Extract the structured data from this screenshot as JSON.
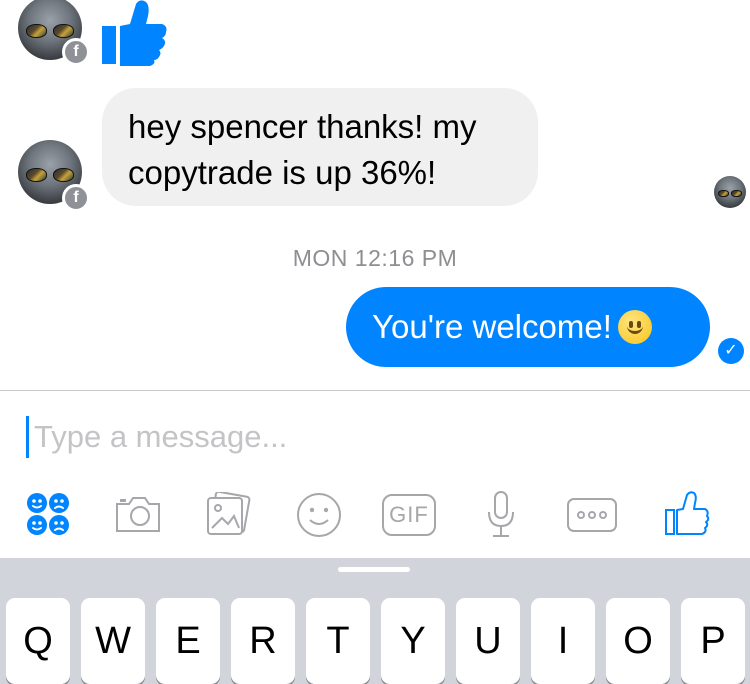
{
  "conversation": {
    "messages": [
      {
        "from": "contact",
        "type": "like"
      },
      {
        "from": "contact",
        "type": "text",
        "lines": [
          "hey spencer thanks! my",
          "copytrade is up 36%!"
        ]
      },
      {
        "from": "me",
        "type": "text",
        "text": "You're welcome!",
        "emoji": "slightly-smiling-face"
      }
    ],
    "timestamp": "MON 12:16 PM",
    "contact_badge": "f"
  },
  "composer": {
    "placeholder": "Type a message..."
  },
  "toolbar": {
    "gif_label": "GIF",
    "items": [
      "stickers-icon",
      "camera-icon",
      "gallery-icon",
      "emoji-icon",
      "gif-button",
      "microphone-icon",
      "more-icon",
      "like-icon"
    ]
  },
  "keyboard": {
    "row1": [
      "Q",
      "W",
      "E",
      "R",
      "T",
      "Y",
      "U",
      "I",
      "O",
      "P"
    ]
  },
  "colors": {
    "accent": "#0084ff",
    "incoming_bubble": "#f0f0f0",
    "timestamp": "#8e8e93",
    "keyboard_bg": "#d1d4da"
  }
}
